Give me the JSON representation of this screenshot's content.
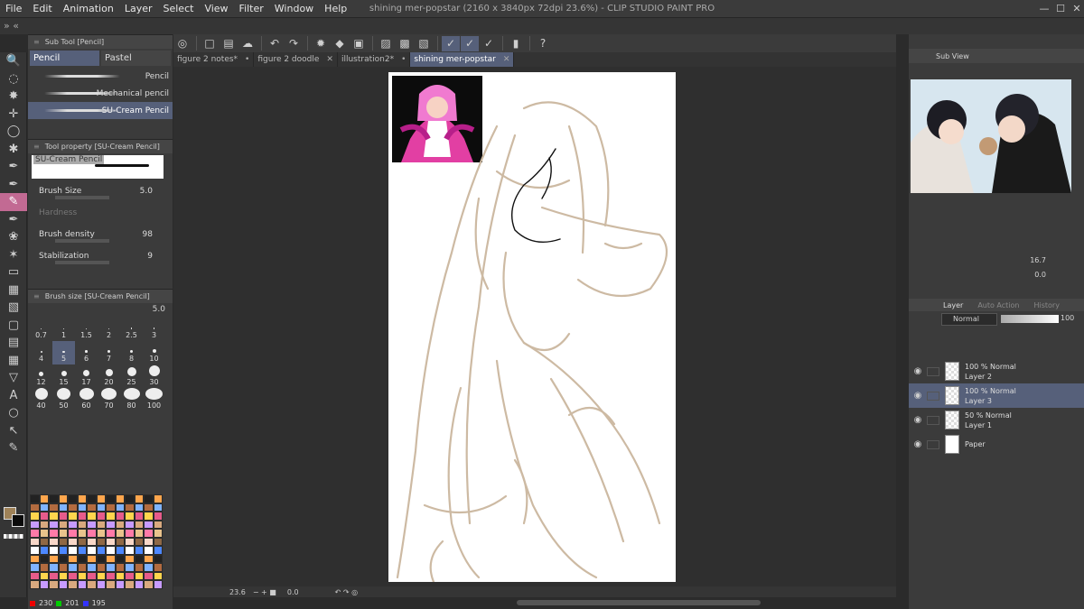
{
  "app": {
    "title": "shining mer-popstar (2160 x 3840px 72dpi 23.6%) - CLIP STUDIO PAINT PRO",
    "window_controls": [
      "—",
      "☐",
      "✕"
    ]
  },
  "menu": [
    "File",
    "Edit",
    "Animation",
    "Layer",
    "Select",
    "View",
    "Filter",
    "Window",
    "Help"
  ],
  "strip_controls": "»  «",
  "command_icons": [
    "◎",
    "□",
    "▤",
    "☁",
    "↶",
    "↷",
    "✹",
    "◆",
    "▣",
    "▨",
    "▩",
    "▧",
    "✓",
    "✓",
    "✓",
    "▮",
    "?"
  ],
  "tools": [
    "🔍",
    "◌",
    "✸",
    "✛",
    "◯",
    "✱",
    "✒",
    "✒",
    "✎",
    "✒",
    "❀",
    "✶",
    "▭",
    "▦",
    "▧",
    "▢",
    "▤",
    "▦",
    "▽",
    "A",
    "○",
    "↖",
    "✎"
  ],
  "main_color": "#9f8258",
  "sub_color": "#0a0a0a",
  "subtool": {
    "header": "Sub Tool [Pencil]",
    "tabs": [
      "Pencil",
      "Pastel"
    ],
    "brushes": [
      "Pencil",
      "Mechanical pencil",
      "SU-Cream Pencil"
    ]
  },
  "tool_property": {
    "header": "Tool property [SU-Cream Pencil]",
    "preview_label": "SU-Cream Pencil",
    "props": [
      {
        "label": "Brush Size",
        "value": "5.0"
      },
      {
        "label": "Hardness",
        "value": ""
      },
      {
        "label": "Brush density",
        "value": "98"
      },
      {
        "label": "Stabilization",
        "value": "9"
      }
    ]
  },
  "brush_size": {
    "header": "Brush size [SU-Cream Pencil]",
    "value": "5.0",
    "sizes": [
      "0.7",
      "1",
      "1.5",
      "2",
      "2.5",
      "3",
      "4",
      "5",
      "6",
      "7",
      "8",
      "10",
      "12",
      "15",
      "17",
      "20",
      "25",
      "30",
      "40",
      "50",
      "60",
      "70",
      "80",
      "100"
    ]
  },
  "color_readout": {
    "r": "230",
    "g": "201",
    "b": "195"
  },
  "doc_tabs": [
    {
      "label": "figure 2 notes*"
    },
    {
      "label": "figure 2 doodle"
    },
    {
      "label": "illustration2*"
    },
    {
      "label": "shining mer-popstar"
    }
  ],
  "status": {
    "zoom": "23.6",
    "rotation": "0.0"
  },
  "subview": {
    "tab": "Sub View",
    "zoom": "16.7",
    "angle": "0.0"
  },
  "layer_panel": {
    "tabs": [
      "Layer",
      "Auto Action",
      "History"
    ],
    "blend_mode": "Normal",
    "opacity": "100",
    "layers": [
      {
        "opacity_mode": "100 % Normal",
        "name": "Layer 2"
      },
      {
        "opacity_mode": "100 % Normal",
        "name": "Layer 3"
      },
      {
        "opacity_mode": "50 % Normal",
        "name": "Layer 1"
      },
      {
        "opacity_mode": "",
        "name": "Paper"
      }
    ]
  }
}
